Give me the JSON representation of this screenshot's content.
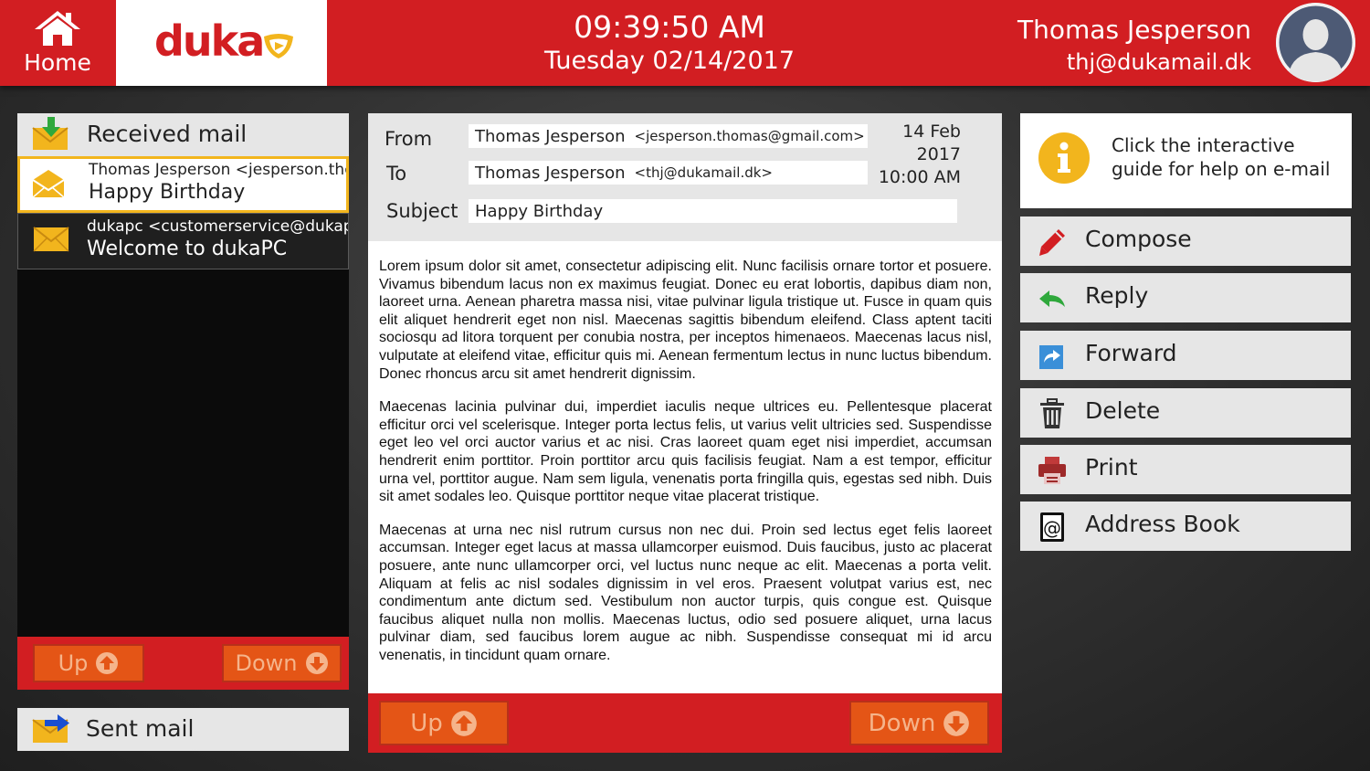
{
  "header": {
    "home_label": "Home",
    "brand": "duka",
    "time": "09:39:50 AM",
    "date": "Tuesday 02/14/2017",
    "user_name": "Thomas Jesperson",
    "user_email": "thj@dukamail.dk"
  },
  "colors": {
    "brand_red": "#d21e22",
    "button_orange": "#e45516",
    "highlight_yellow": "#f2b51d",
    "panel_gray": "#e6e6e6"
  },
  "left": {
    "received_label": "Received mail",
    "mails": [
      {
        "sender": "Thomas Jesperson <jesperson.thomas@gmail.com>",
        "subject": "Happy Birthday",
        "selected": true
      },
      {
        "sender": "dukapc <customerservice@dukapc.dk>",
        "subject": "Welcome to dukaPC",
        "selected": false
      }
    ],
    "up_label": "Up",
    "down_label": "Down",
    "sent_label": "Sent mail"
  },
  "message": {
    "from_label": "From",
    "to_label": "To",
    "subject_label": "Subject",
    "from_name": "Thomas Jesperson",
    "from_address": "<jesperson.thomas@gmail.com>",
    "to_name": "Thomas Jesperson",
    "to_address": "<thj@dukamail.dk>",
    "subject": "Happy Birthday",
    "date_day": "14 Feb",
    "date_year": "2017",
    "date_time": "10:00 AM",
    "body": [
      "Lorem ipsum dolor sit amet, consectetur adipiscing elit. Nunc facilisis ornare tortor et posuere. Vivamus bibendum lacus non ex maximus feugiat. Donec eu erat lobortis, dapibus diam non, laoreet urna. Aenean pharetra massa nisi, vitae pulvinar ligula tristique ut. Fusce in quam quis elit aliquet hendrerit eget non nisl. Maecenas sagittis bibendum eleifend. Class aptent taciti sociosqu ad litora torquent per conubia nostra, per inceptos himenaeos. Maecenas lacus nisl, vulputate at eleifend vitae, efficitur quis mi. Aenean fermentum lectus in nunc luctus bibendum. Donec rhoncus arcu sit amet hendrerit dignissim.",
      "Maecenas lacinia pulvinar dui, imperdiet iaculis neque ultrices eu. Pellentesque placerat efficitur orci vel scelerisque. Integer porta lectus felis, ut varius velit ultricies sed. Suspendisse eget leo vel orci auctor varius et ac nisi. Cras laoreet quam eget nisi imperdiet, accumsan hendrerit enim porttitor. Proin porttitor arcu quis facilisis feugiat. Nam a est tempor, efficitur urna vel, porttitor augue. Nam sem ligula, venenatis porta fringilla quis, egestas sed nibh. Duis sit amet sodales leo. Quisque porttitor neque vitae placerat tristique.",
      "Maecenas at urna nec nisl rutrum cursus non nec dui. Proin sed lectus eget felis laoreet accumsan. Integer eget lacus at massa ullamcorper euismod. Duis faucibus, justo ac placerat posuere, ante nunc ullamcorper orci, vel luctus nunc neque ac elit. Maecenas a porta velit. Aliquam at felis ac nisl sodales dignissim in vel eros. Praesent volutpat varius est, nec condimentum ante dictum sed. Vestibulum non auctor turpis, quis congue est. Quisque faucibus aliquet nulla non mollis. Maecenas luctus, odio sed posuere aliquet, urna lacus pulvinar diam, sed faucibus lorem augue ac nibh. Suspendisse consequat mi id arcu venenatis, in tincidunt quam ornare."
    ],
    "up_label": "Up",
    "down_label": "Down"
  },
  "right": {
    "help_line1": "Click the interactive",
    "help_line2": "guide for help on e-mail",
    "actions": {
      "compose": "Compose",
      "reply": "Reply",
      "forward": "Forward",
      "delete": "Delete",
      "print": "Print",
      "address_book": "Address Book"
    }
  },
  "icons": [
    "home-icon",
    "logo-play-icon",
    "avatar-icon",
    "inbox-icon",
    "envelope-icon",
    "up-arrow-icon",
    "down-arrow-icon",
    "sent-icon",
    "info-icon",
    "pencil-icon",
    "reply-icon",
    "forward-icon",
    "trash-icon",
    "printer-icon",
    "address-book-icon"
  ]
}
